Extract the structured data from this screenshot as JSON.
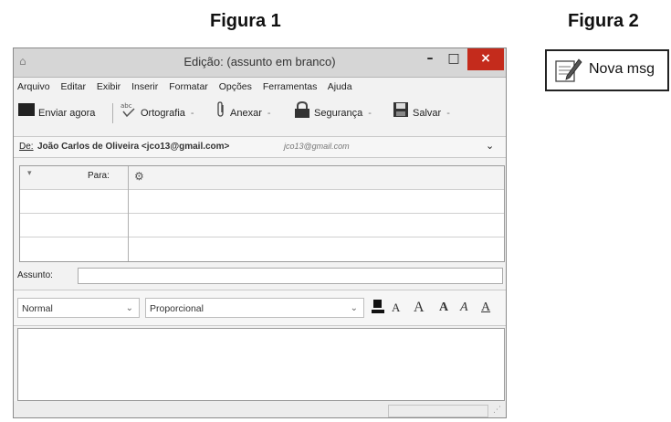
{
  "figures": {
    "fig1": "Figura 1",
    "fig2": "Figura 2"
  },
  "window": {
    "title": "Edição: (assunto em branco)",
    "minimize": "–",
    "maximize": "□",
    "close": "×"
  },
  "menu": [
    {
      "label": "Arquivo"
    },
    {
      "label": "Editar"
    },
    {
      "label": "Exibir"
    },
    {
      "label": "Inserir"
    },
    {
      "label": "Formatar"
    },
    {
      "label": "Opções"
    },
    {
      "label": "Ferramentas"
    },
    {
      "label": "Ajuda"
    }
  ],
  "toolbar": {
    "send": "Enviar agora",
    "spell": "Ortografia",
    "attach": "Anexar",
    "security": "Segurança",
    "save": "Salvar",
    "dropdown": "-"
  },
  "from": {
    "label": "De:",
    "value": "João Carlos de Oliveira <jco13@gmail.com>",
    "account": "jco13@gmail.com"
  },
  "recipients": {
    "header": "Para:"
  },
  "subject": {
    "label": "Assunto:",
    "value": ""
  },
  "format": {
    "paragraph": "Normal",
    "font": "Proporcional",
    "smaller": "A",
    "larger": "A",
    "bold": "A",
    "italic": "A",
    "underline": "A"
  },
  "figure2": {
    "button_label": "Nova msg",
    "icon": "compose-icon"
  }
}
